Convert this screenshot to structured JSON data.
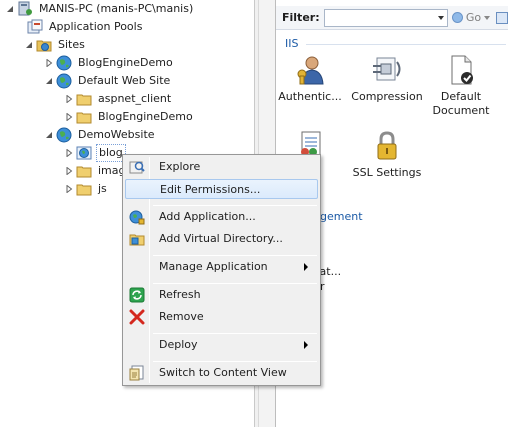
{
  "tree": {
    "server": "MANIS-PC (manis-PC\\manis)",
    "app_pools": "Application Pools",
    "sites": "Sites",
    "blogengine_site": "BlogEngineDemo",
    "default_site": "Default Web Site",
    "aspnet_client": "aspnet_client",
    "blogengine_app": "BlogEngineDemo",
    "demo_site": "DemoWebsite",
    "blog": "blog",
    "images": "imag",
    "js": "js"
  },
  "filter": {
    "label": "Filter:",
    "go": "Go"
  },
  "features": {
    "heading": "IIS",
    "items": [
      "Authentic...",
      "Compression",
      "Default Document",
      "...st ...ng",
      "SSL Settings"
    ],
    "item4_line1": "st",
    "item4_line2": "ng",
    "mgmt_heading": "gement",
    "frag1": "rat...",
    "frag2": "r"
  },
  "context_menu": {
    "explore": "Explore",
    "edit_permissions": "Edit Permissions...",
    "add_application": "Add Application...",
    "add_virtual_directory": "Add Virtual Directory...",
    "manage_application": "Manage Application",
    "refresh": "Refresh",
    "remove": "Remove",
    "deploy": "Deploy",
    "switch_content_view": "Switch to Content View"
  },
  "colors": {
    "accent": "#1b5aa6",
    "highlight_border": "#a8c8ee",
    "folder": "#e8c35a"
  }
}
